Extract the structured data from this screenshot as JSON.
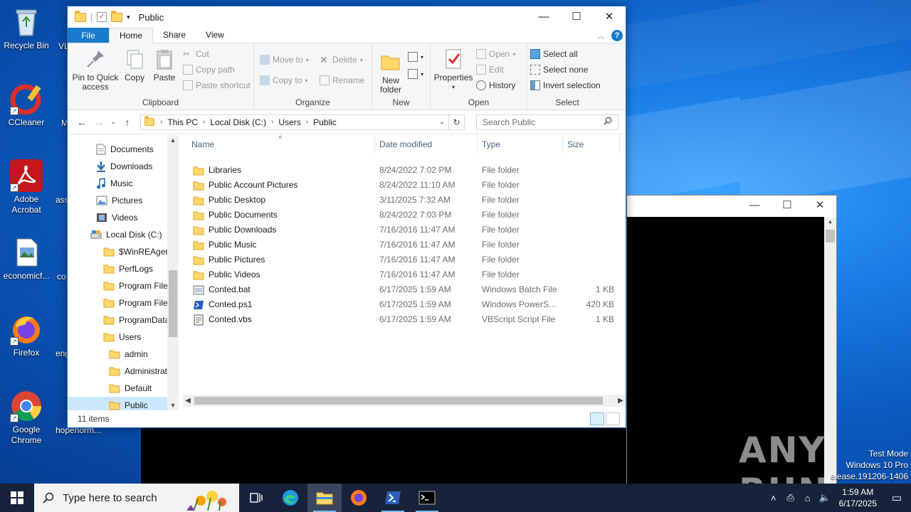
{
  "desktop": {
    "icons": [
      {
        "label": "Recycle Bin"
      },
      {
        "label": "CCleaner"
      },
      {
        "label": "Adobe Acrobat"
      },
      {
        "label": "economicf..."
      },
      {
        "label": "Firefox"
      },
      {
        "label": "Google Chrome"
      }
    ],
    "partial_labels": [
      "VL",
      "M",
      "ass",
      "co",
      "eng",
      "hopenorm..."
    ]
  },
  "explorer": {
    "title": "Public",
    "tabs": {
      "file": "File",
      "home": "Home",
      "share": "Share",
      "view": "View"
    },
    "ribbon": {
      "clipboard": {
        "group": "Clipboard",
        "pin": "Pin to Quick access",
        "copy": "Copy",
        "paste": "Paste",
        "cut": "Cut",
        "copy_path": "Copy path",
        "paste_shortcut": "Paste shortcut"
      },
      "organize": {
        "group": "Organize",
        "move_to": "Move to",
        "copy_to": "Copy to",
        "delete": "Delete",
        "rename": "Rename"
      },
      "new": {
        "group": "New",
        "new_folder": "New folder"
      },
      "open": {
        "group": "Open",
        "properties": "Properties",
        "open": "Open",
        "edit": "Edit",
        "history": "History"
      },
      "select": {
        "group": "Select",
        "select_all": "Select all",
        "select_none": "Select none",
        "invert": "Invert selection"
      }
    },
    "address": {
      "crumbs": [
        "This PC",
        "Local Disk (C:)",
        "Users",
        "Public"
      ]
    },
    "search": {
      "placeholder": "Search Public"
    },
    "nav": [
      {
        "label": "Documents",
        "icon": "documents-icon"
      },
      {
        "label": "Downloads",
        "icon": "downloads-icon"
      },
      {
        "label": "Music",
        "icon": "music-icon"
      },
      {
        "label": "Pictures",
        "icon": "pictures-icon"
      },
      {
        "label": "Videos",
        "icon": "videos-icon"
      },
      {
        "label": "Local Disk (C:)",
        "icon": "drive-icon"
      },
      {
        "label": "$WinREAgent",
        "icon": "folder-icon"
      },
      {
        "label": "PerfLogs",
        "icon": "folder-icon"
      },
      {
        "label": "Program Files",
        "icon": "folder-icon"
      },
      {
        "label": "Program Files",
        "icon": "folder-icon"
      },
      {
        "label": "ProgramData",
        "icon": "folder-icon"
      },
      {
        "label": "Users",
        "icon": "folder-icon"
      },
      {
        "label": "admin",
        "icon": "folder-icon"
      },
      {
        "label": "Administrat",
        "icon": "folder-icon"
      },
      {
        "label": "Default",
        "icon": "folder-icon"
      },
      {
        "label": "Public",
        "icon": "folder-icon"
      }
    ],
    "columns": {
      "name": "Name",
      "date": "Date modified",
      "type": "Type",
      "size": "Size"
    },
    "files": [
      {
        "name": "Libraries",
        "date": "8/24/2022 7:02 PM",
        "type": "File folder",
        "size": "",
        "icon": "folder-icon"
      },
      {
        "name": "Public Account Pictures",
        "date": "8/24/2022 11:10 AM",
        "type": "File folder",
        "size": "",
        "icon": "folder-icon"
      },
      {
        "name": "Public Desktop",
        "date": "3/11/2025 7:32 AM",
        "type": "File folder",
        "size": "",
        "icon": "folder-icon"
      },
      {
        "name": "Public Documents",
        "date": "8/24/2022 7:03 PM",
        "type": "File folder",
        "size": "",
        "icon": "folder-icon"
      },
      {
        "name": "Public Downloads",
        "date": "7/16/2016 11:47 AM",
        "type": "File folder",
        "size": "",
        "icon": "folder-icon"
      },
      {
        "name": "Public Music",
        "date": "7/16/2016 11:47 AM",
        "type": "File folder",
        "size": "",
        "icon": "folder-icon"
      },
      {
        "name": "Public Pictures",
        "date": "7/16/2016 11:47 AM",
        "type": "File folder",
        "size": "",
        "icon": "folder-icon"
      },
      {
        "name": "Public Videos",
        "date": "7/16/2016 11:47 AM",
        "type": "File folder",
        "size": "",
        "icon": "folder-icon"
      },
      {
        "name": "Conted.bat",
        "date": "6/17/2025 1:59 AM",
        "type": "Windows Batch File",
        "size": "1 KB",
        "icon": "batch-file-icon"
      },
      {
        "name": "Conted.ps1",
        "date": "6/17/2025 1:59 AM",
        "type": "Windows PowerS...",
        "size": "420 KB",
        "icon": "powershell-file-icon"
      },
      {
        "name": "Conted.vbs",
        "date": "6/17/2025 1:59 AM",
        "type": "VBScript Script File",
        "size": "1 KB",
        "icon": "vbscript-file-icon"
      }
    ],
    "status": "11 items"
  },
  "watermark": "ANY RUN",
  "test_mode": {
    "line1": "Test Mode",
    "line2": "Windows 10 Pro",
    "line3": "elease.191206-1406"
  },
  "taskbar": {
    "search_placeholder": "Type here to search",
    "time": "1:59 AM",
    "date": "6/17/2025"
  },
  "colors": {
    "accent": "#1979ca",
    "selection": "#cce8ff",
    "taskbar": "#16233a"
  }
}
